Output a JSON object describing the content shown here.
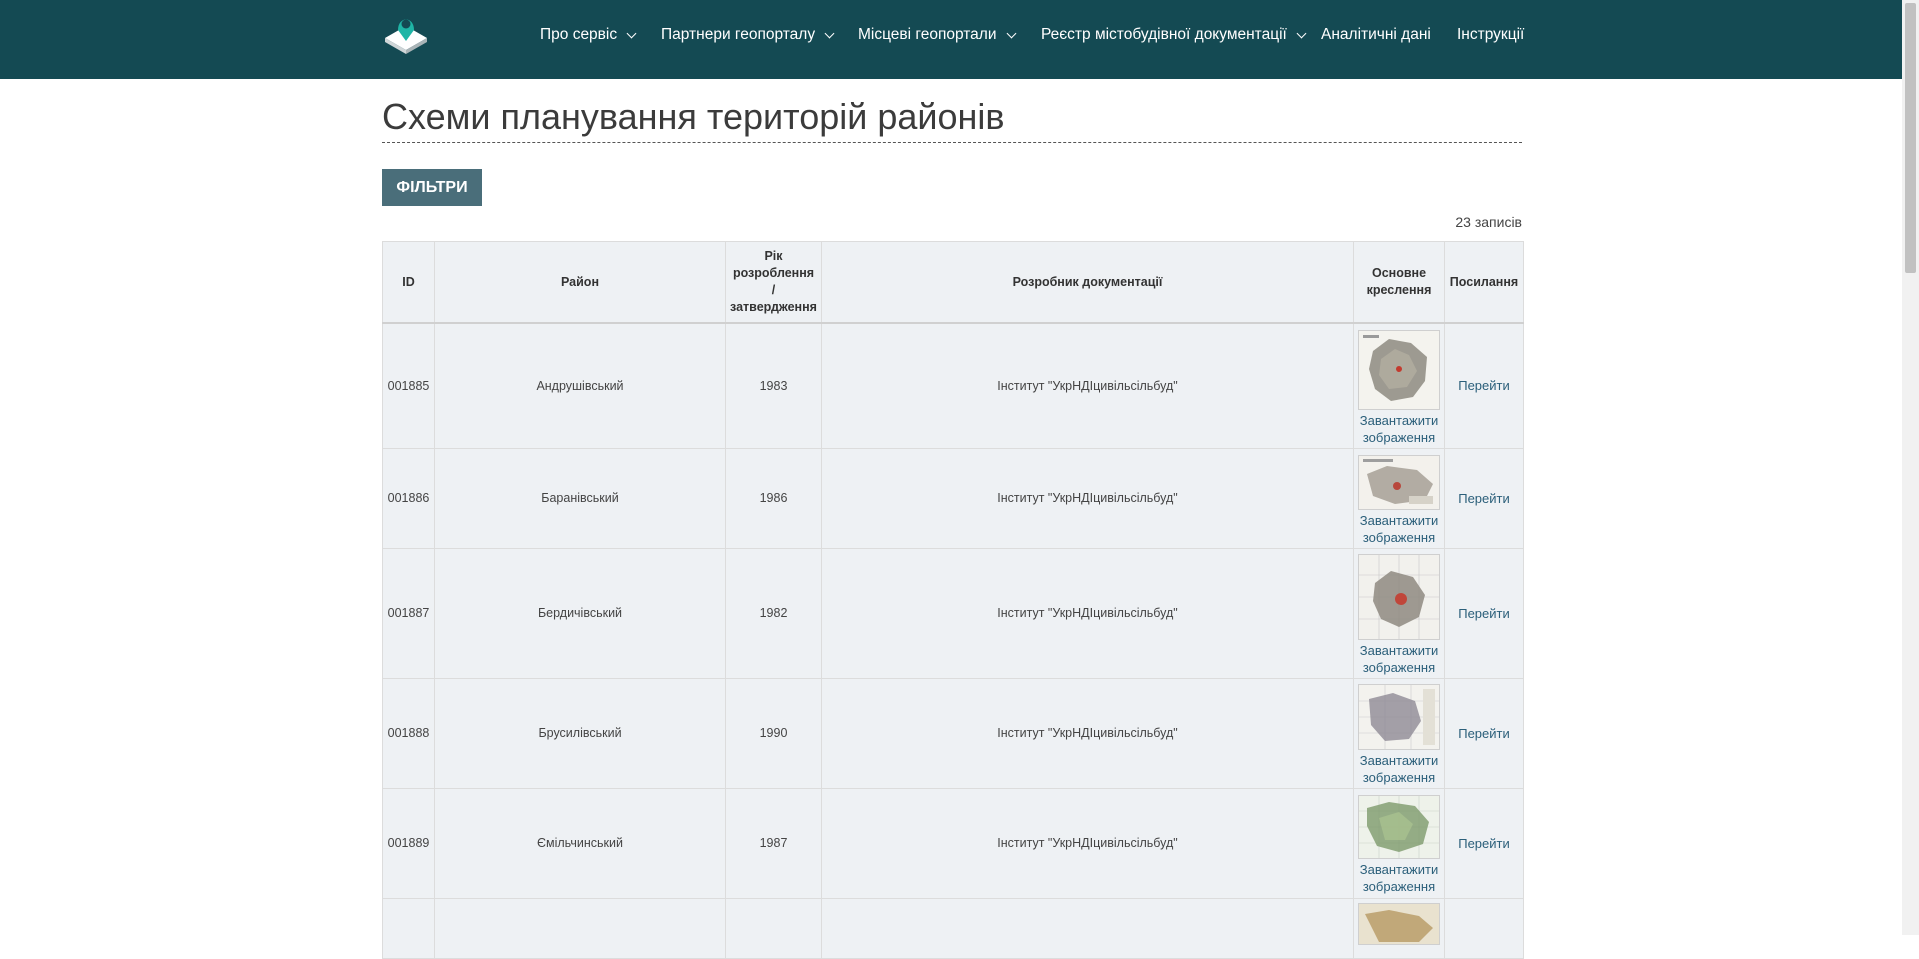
{
  "header": {
    "logo_icon": "map-pin-logo-icon",
    "background_color": "#144a53",
    "nav": [
      {
        "label": "Про сервіс",
        "has_dropdown": true
      },
      {
        "label": "Партнери геопорталу",
        "has_dropdown": true
      },
      {
        "label": "Місцеві геопортали",
        "has_dropdown": true
      },
      {
        "label": "Реєстр містобудівної документації",
        "has_dropdown": true
      },
      {
        "label": "Аналітичні дані",
        "has_dropdown": false
      },
      {
        "label": "Інструкції",
        "has_dropdown": false
      }
    ]
  },
  "page": {
    "title": "Схеми планування територій районів",
    "filter_button": "ФІЛЬТРИ",
    "record_count": "23 записів",
    "accent_color": "#4a6e7a"
  },
  "table": {
    "headers": {
      "id": "ID",
      "district": "Район",
      "year": "Рік розроблення / затвердження",
      "developer": "Розробник документації",
      "drawing": "Основне креслення",
      "link": "Посилання"
    },
    "rows": [
      {
        "id": "001885",
        "district": "Андрушівський",
        "year": "1983",
        "developer": "Інститут \"УкрНДІцивільсільбуд\"",
        "download": "Завантажити зображення",
        "link": "Перейти"
      },
      {
        "id": "001886",
        "district": "Баранівський",
        "year": "1986",
        "developer": "Інститут \"УкрНДІцивільсільбуд\"",
        "download": "Завантажити зображення",
        "link": "Перейти"
      },
      {
        "id": "001887",
        "district": "Бердичівський",
        "year": "1982",
        "developer": "Інститут \"УкрНДІцивільсільбуд\"",
        "download": "Завантажити зображення",
        "link": "Перейти"
      },
      {
        "id": "001888",
        "district": "Брусилівський",
        "year": "1990",
        "developer": "Інститут \"УкрНДІцивільсільбуд\"",
        "download": "Завантажити зображення",
        "link": "Перейти"
      },
      {
        "id": "001889",
        "district": "Ємільчинський",
        "year": "1987",
        "developer": "Інститут \"УкрНДІцивільсільбуд\"",
        "download": "Завантажити зображення",
        "link": "Перейти"
      }
    ]
  }
}
